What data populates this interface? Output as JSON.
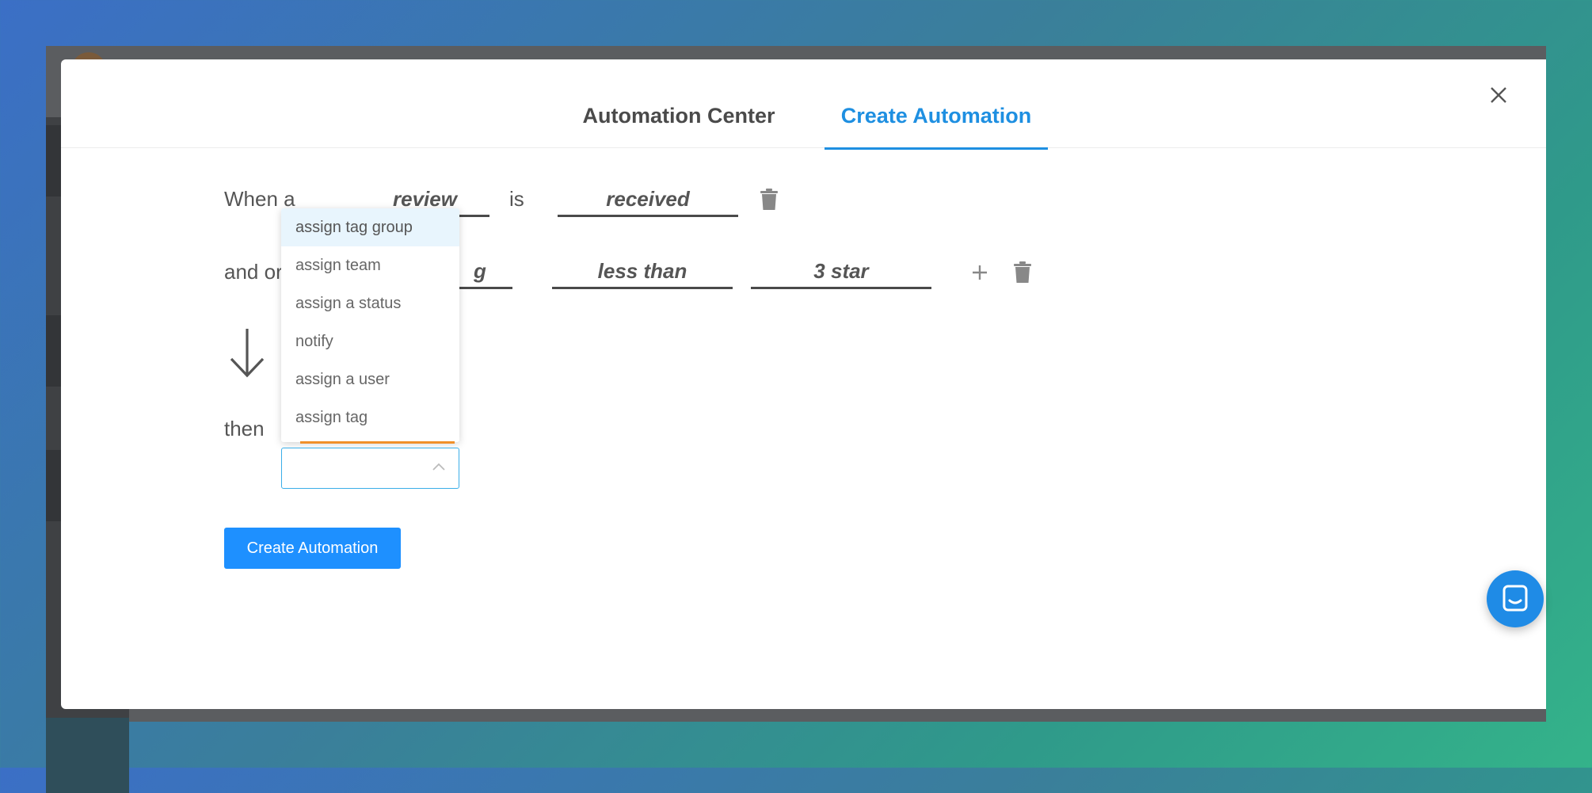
{
  "tabs": {
    "automation_center": "Automation Center",
    "create_automation": "Create Automation"
  },
  "rule": {
    "when_label": "When a",
    "trigger_object": "review",
    "is_label": "is",
    "trigger_event": "received",
    "and_or_label": "and or",
    "condition_field_partial": "g",
    "condition_operator": "less than",
    "condition_value": "3 star",
    "then_label": "then"
  },
  "action_dropdown": {
    "options": [
      "assign tag group",
      "assign team",
      "assign a status",
      "notify",
      "assign a user",
      "assign tag"
    ],
    "highlighted_index": 0,
    "selected_value": ""
  },
  "create_button": "Create Automation",
  "colors": {
    "accent": "#1e8fe1",
    "button": "#1e90ff",
    "orange_underline": "#f0902a",
    "highlight": "#e8f5fd"
  },
  "icons": [
    "close-icon",
    "trash-icon",
    "plus-icon",
    "arrow-down-icon",
    "chevron-up-icon",
    "chat-icon"
  ]
}
